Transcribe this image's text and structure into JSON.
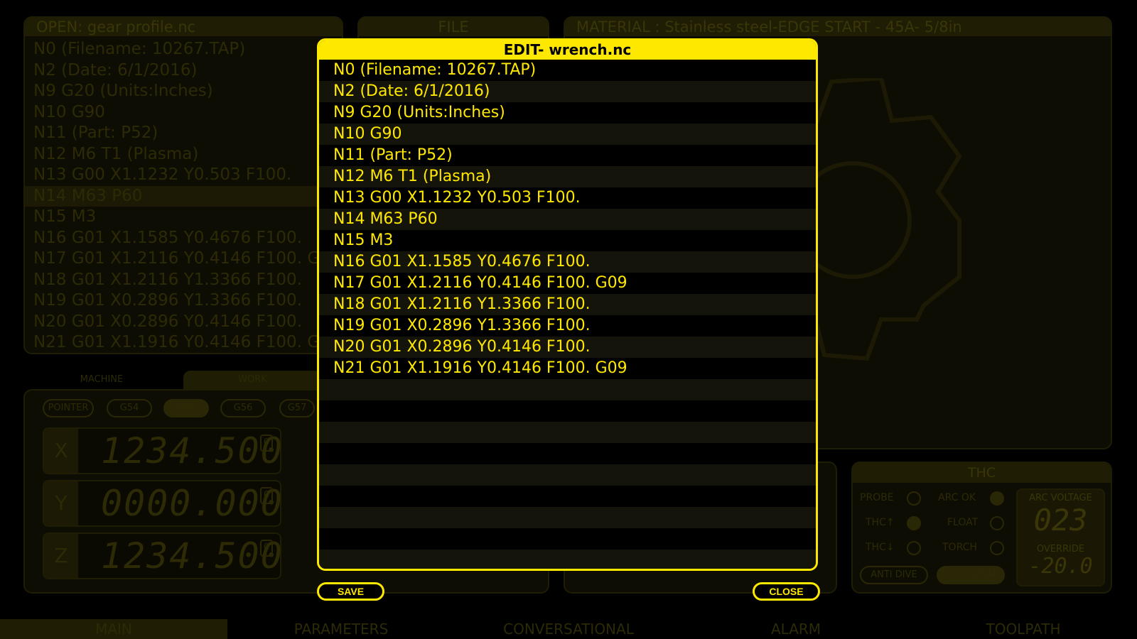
{
  "background": {
    "gcode_panel": {
      "title": "OPEN: gear profile.nc",
      "lines": [
        "N0 (Filename: 10267.TAP)",
        "N2 (Date: 6/1/2016)",
        "N9 G20 (Units:Inches)",
        "N10 G90",
        "N11 (Part: P52)",
        "N12 M6 T1 (Plasma)",
        "N13 G00 X1.1232 Y0.503 F100.",
        "N14 M63 P60",
        "N15 M3",
        "N16 G01 X1.1585 Y0.4676 F100.",
        "N17 G01 X1.2116 Y0.4146 F100. G09",
        "N18 G01 X1.2116 Y1.3366 F100.",
        "N19 G01 X0.2896 Y1.3366 F100.",
        "N20 G01 X0.2896 Y0.4146 F100.",
        "N21 G01 X1.1916 Y0.4146 F100. G09"
      ],
      "highlighted_index": 7
    },
    "file_panel": {
      "title": "FILE"
    },
    "material_panel": {
      "title": "MATERIAL : Stainless steel-EDGE START - 45A- 5/8in"
    },
    "coords": {
      "tabs": [
        "MACHINE",
        "WORK"
      ],
      "chips": [
        "POINTER",
        "G54",
        "G55",
        "G56",
        "G57"
      ],
      "active_chip": "G55",
      "dro": [
        {
          "axis": "X",
          "value": "1234.500",
          "zero": "0"
        },
        {
          "axis": "Y",
          "value": "0000.000",
          "zero": "0"
        },
        {
          "axis": "Z",
          "value": "1234.500",
          "zero": "0"
        }
      ]
    },
    "thc": {
      "title": "THC",
      "indicators": [
        {
          "label": "PROBE",
          "on": false
        },
        {
          "label": "ARC OK",
          "on": true
        },
        {
          "label": "THC↑",
          "on": true
        },
        {
          "label": "FLOAT",
          "on": false
        },
        {
          "label": "THC↓",
          "on": false
        },
        {
          "label": "TORCH",
          "on": false
        }
      ],
      "arc_voltage_label": "ARC VOLTAGE",
      "arc_voltage": "023",
      "override_label": "OVERRIDE",
      "override_value": "-20.0",
      "buttons": [
        "ANTI DIVE",
        "VOID SENSE"
      ]
    },
    "bottom_tabs": [
      "MAIN",
      "PARAMETERS",
      "CONVERSATIONAL",
      "ALARM",
      "TOOLPATH"
    ],
    "active_tab": "MAIN"
  },
  "dialog": {
    "title": "EDIT- wrench.nc",
    "lines": [
      "N0 (Filename: 10267.TAP)",
      "N2 (Date: 6/1/2016)",
      "N9 G20 (Units:Inches)",
      "N10 G90",
      "N11 (Part: P52)",
      "N12 M6 T1 (Plasma)",
      "N13 G00 X1.1232 Y0.503 F100.",
      "N14 M63 P60",
      "N15 M3",
      "N16 G01 X1.1585 Y0.4676 F100.",
      "N17 G01 X1.2116 Y0.4146 F100. G09",
      "N18 G01 X1.2116 Y1.3366 F100.",
      "N19 G01 X0.2896 Y1.3366 F100.",
      "N20 G01 X0.2896 Y0.4146 F100.",
      "N21 G01 X1.1916 Y0.4146 F100. G09"
    ],
    "empty_rows": 9,
    "save_label": "SAVE",
    "close_label": "CLOSE"
  },
  "colors": {
    "accent": "#FFE800",
    "background": "#000000",
    "stripe": "#15140A"
  }
}
